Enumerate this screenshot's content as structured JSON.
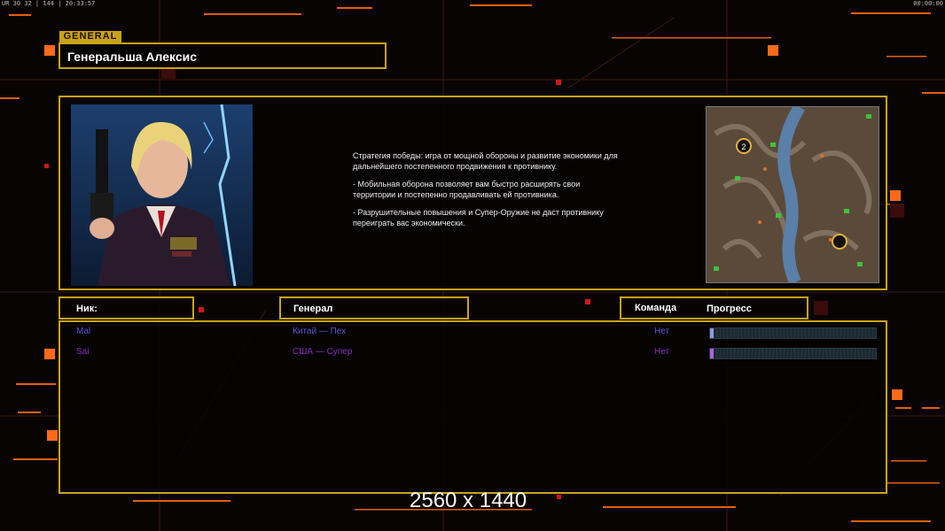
{
  "hud": {
    "left_text": "UR 30 32 | 144 | 20:33:57",
    "right_text": "00:00:00"
  },
  "header": {
    "tag": "GENERAL",
    "general_name": "Генеральша Алексис"
  },
  "description": [
    "Стратегия победы: игра от мощной обороны и развитие экономики для дальнейшего постепенного продвижения к противнику.",
    "- Мобильная оборона позволяет вам быстро расширять свои территории и постепенно продавливать ей противника.",
    "- Разрушительные повышения и Супер-Оружие не даст противнику переиграть вас экономически."
  ],
  "minimap": {
    "start_marker": "2"
  },
  "columns": {
    "nick": "Ник:",
    "general": "Генерал",
    "team": "Команда",
    "progress": "Прогресс"
  },
  "players": [
    {
      "nick": "Mal",
      "general": "Китай — Пех",
      "team": "Нет",
      "progress": 0.02,
      "color": "#5a5ad8"
    },
    {
      "nick": "Sai",
      "general": "США — Супер",
      "team": "Нет",
      "progress": 0.02,
      "color": "#8a2fc0"
    }
  ],
  "resolution": "2560 x 1440",
  "colors": {
    "accent": "#c9a316",
    "orange": "#ff6a10"
  }
}
